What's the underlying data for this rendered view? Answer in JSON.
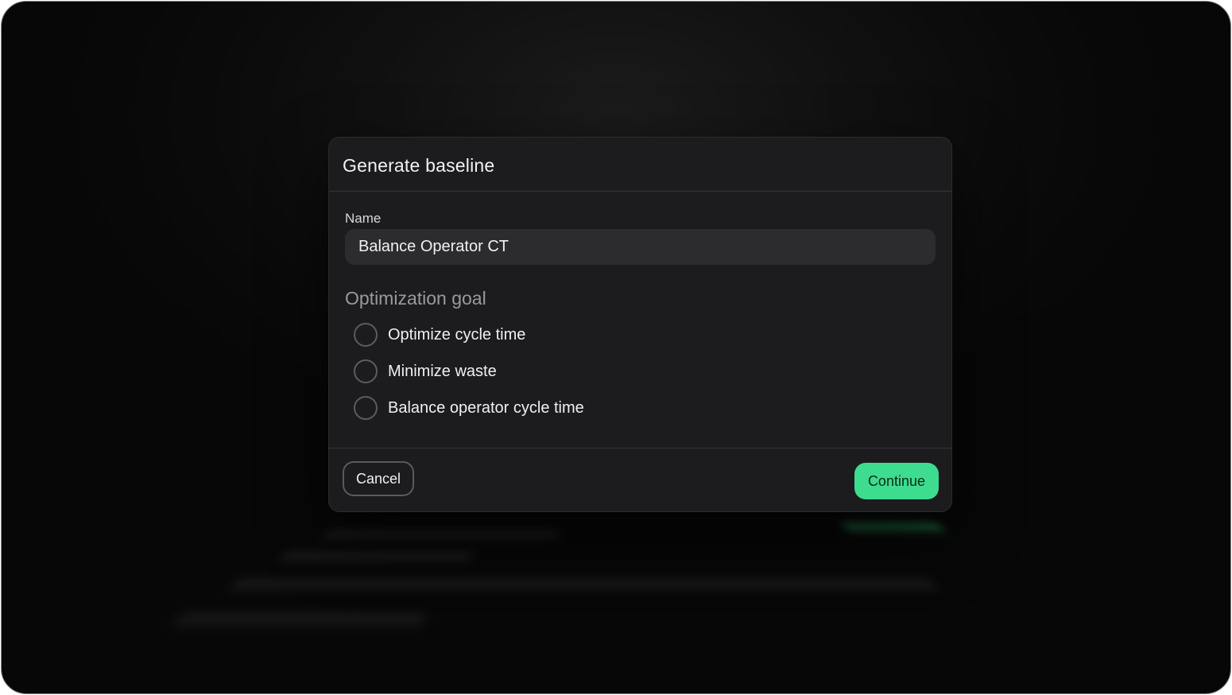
{
  "dialog": {
    "title": "Generate baseline",
    "name_label": "Name",
    "name_value": "Balance Operator CT",
    "goal_title": "Optimization goal",
    "goal_options": [
      {
        "label": "Optimize cycle time",
        "selected": false
      },
      {
        "label": "Minimize waste",
        "selected": false
      },
      {
        "label": "Balance operator cycle time",
        "selected": false
      }
    ],
    "cancel_label": "Cancel",
    "continue_label": "Continue"
  },
  "colors": {
    "accent": "#3ddc8f",
    "dialog_bg": "#1c1c1e",
    "input_bg": "#2c2c2e",
    "backdrop": "#0a0a0a"
  }
}
